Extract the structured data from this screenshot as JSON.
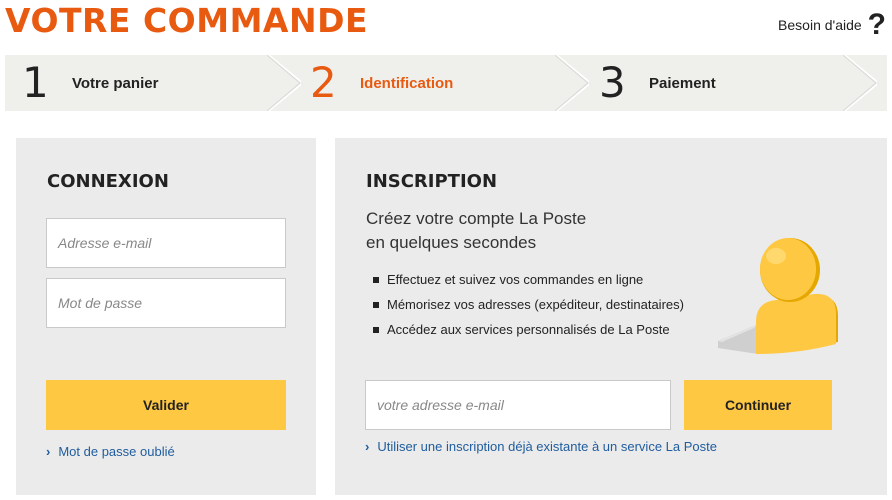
{
  "header": {
    "title": "VOTRE COMMANDE",
    "help_label": "Besoin d'aide",
    "help_icon_glyph": "?"
  },
  "steps": [
    {
      "number": "1",
      "label": "Votre panier",
      "active": false
    },
    {
      "number": "2",
      "label": "Identification",
      "active": true
    },
    {
      "number": "3",
      "label": "Paiement",
      "active": false
    }
  ],
  "login": {
    "title": "CONNEXION",
    "email_placeholder": "Adresse e-mail",
    "password_placeholder": "Mot de passe",
    "submit_label": "Valider",
    "forgot_link": "Mot de passe oublié"
  },
  "signup": {
    "title": "INSCRIPTION",
    "subtitle_line1": "Créez votre compte La Poste",
    "subtitle_line2": "en quelques secondes",
    "features": [
      "Effectuez et suivez vos commandes en ligne",
      "Mémorisez vos adresses (expéditeur, destinataires)",
      "Accédez aux services personnalisés de La Poste"
    ],
    "email_placeholder": "votre adresse e-mail",
    "continue_label": "Continuer",
    "existing_link": "Utiliser une inscription déjà existante à un service La Poste"
  },
  "colors": {
    "accent_orange": "#e95a11",
    "button_yellow": "#ffc843",
    "link_blue": "#205d9e",
    "panel_gray": "#ebebeb"
  }
}
